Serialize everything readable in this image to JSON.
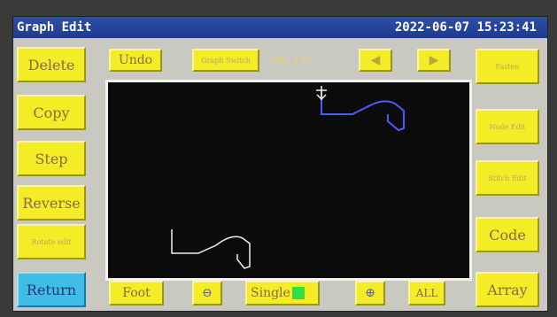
{
  "title": "Graph Edit",
  "datetime": "2022-06-07 15:23:41",
  "left_buttons": [
    "Delete",
    "Copy",
    "Step",
    "Reverse",
    "Rotate edit",
    "Return"
  ],
  "top_bar": {
    "undo": "Undo",
    "graph_switch": "Graph Switch",
    "step_info": "Step: 2.50",
    "prev_icon": "left-arrow-icon",
    "next_icon": "right-arrow-icon"
  },
  "right_buttons": [
    "Fasten",
    "Node Edit",
    "Stitch Edit",
    "Code",
    "Array"
  ],
  "bottom_bar": {
    "foot": "Foot",
    "zoom_out_icon": "zoom-out-icon",
    "single": "Single",
    "zoom_in_icon": "zoom-in-icon",
    "all": "ALL"
  },
  "colors": {
    "button": "#f3ec26",
    "return_button": "#3fbde8",
    "titlebar": "#2f4fa8",
    "canvas": "#0b0b0b",
    "selected_path": "#4a5cff",
    "other_path": "#f2f2ee",
    "single_indicator": "#2fe04a"
  }
}
